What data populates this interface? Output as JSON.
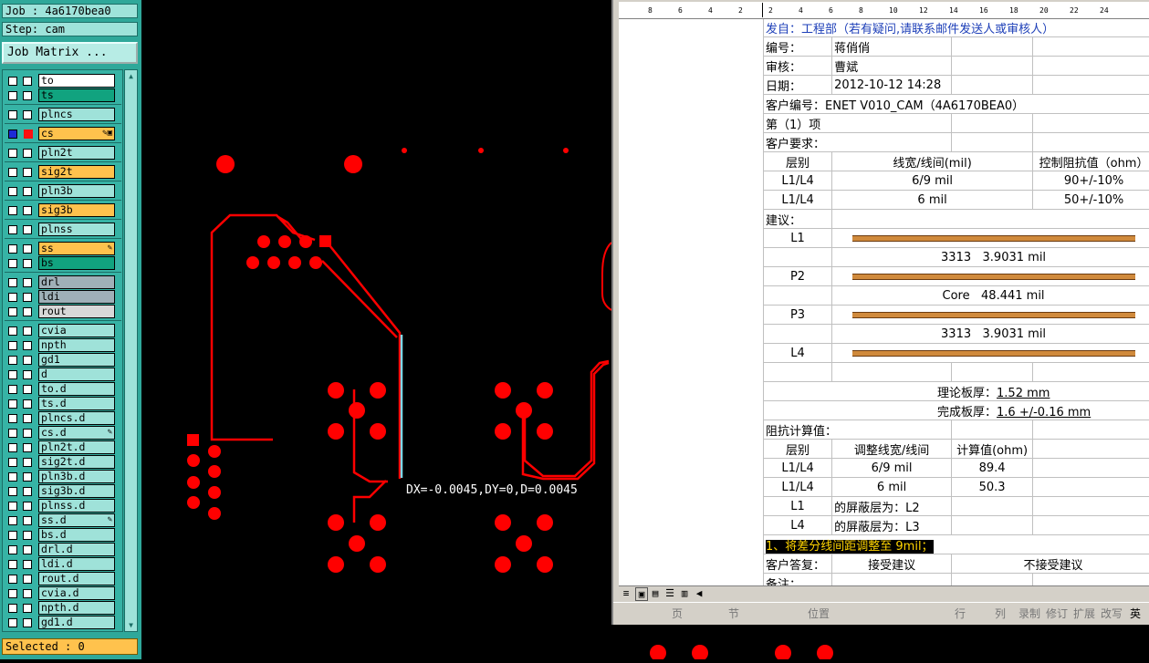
{
  "left_panel": {
    "job_label": "Job : 4a6170bea0",
    "step_label": "Step: cam",
    "matrix_button": "Job Matrix ...",
    "selected_label": "Selected : 0",
    "layers": [
      {
        "name": "to",
        "color": "#ffffff",
        "mark": ""
      },
      {
        "name": "ts",
        "color": "#11a37f",
        "mark": ""
      },
      {
        "name": "plncs",
        "color": "#9fe2d9",
        "mark": ""
      },
      {
        "name": "cs",
        "color": "#ffc24d",
        "mark": "✎▣",
        "active": true
      },
      {
        "name": "pln2t",
        "color": "#9fe2d9",
        "mark": ""
      },
      {
        "name": "sig2t",
        "color": "#ffc24d",
        "mark": ""
      },
      {
        "name": "pln3b",
        "color": "#9fe2d9",
        "mark": ""
      },
      {
        "name": "sig3b",
        "color": "#ffc24d",
        "mark": ""
      },
      {
        "name": "plnss",
        "color": "#9fe2d9",
        "mark": ""
      },
      {
        "name": "ss",
        "color": "#ffc24d",
        "mark": "✎"
      },
      {
        "name": "bs",
        "color": "#11a37f",
        "mark": ""
      },
      {
        "name": "drl",
        "color": "#9fb0b8",
        "mark": ""
      },
      {
        "name": "ldi",
        "color": "#9fb0b8",
        "mark": ""
      },
      {
        "name": "rout",
        "color": "#d8d8d8",
        "mark": ""
      },
      {
        "name": "cvia",
        "color": "#9fe2d9",
        "mark": ""
      },
      {
        "name": "npth",
        "color": "#9fe2d9",
        "mark": ""
      },
      {
        "name": "gd1",
        "color": "#9fe2d9",
        "mark": ""
      },
      {
        "name": "d",
        "color": "#9fe2d9",
        "mark": ""
      },
      {
        "name": "to.d",
        "color": "#9fe2d9",
        "mark": ""
      },
      {
        "name": "ts.d",
        "color": "#9fe2d9",
        "mark": ""
      },
      {
        "name": "plncs.d",
        "color": "#9fe2d9",
        "mark": ""
      },
      {
        "name": "cs.d",
        "color": "#9fe2d9",
        "mark": "✎"
      },
      {
        "name": "pln2t.d",
        "color": "#9fe2d9",
        "mark": ""
      },
      {
        "name": "sig2t.d",
        "color": "#9fe2d9",
        "mark": ""
      },
      {
        "name": "pln3b.d",
        "color": "#9fe2d9",
        "mark": ""
      },
      {
        "name": "sig3b.d",
        "color": "#9fe2d9",
        "mark": ""
      },
      {
        "name": "plnss.d",
        "color": "#9fe2d9",
        "mark": ""
      },
      {
        "name": "ss.d",
        "color": "#9fe2d9",
        "mark": "✎"
      },
      {
        "name": "bs.d",
        "color": "#9fe2d9",
        "mark": ""
      },
      {
        "name": "drl.d",
        "color": "#9fe2d9",
        "mark": ""
      },
      {
        "name": "ldi.d",
        "color": "#9fe2d9",
        "mark": ""
      },
      {
        "name": "rout.d",
        "color": "#9fe2d9",
        "mark": ""
      },
      {
        "name": "cvia.d",
        "color": "#9fe2d9",
        "mark": ""
      },
      {
        "name": "npth.d",
        "color": "#9fe2d9",
        "mark": ""
      },
      {
        "name": "gd1.d",
        "color": "#9fe2d9",
        "mark": ""
      }
    ]
  },
  "canvas": {
    "measure_text": "DX=-0.0045,DY=0,D=0.0045",
    "pad_color": "#ff0000",
    "highlight_color": "#7fd8e8"
  },
  "word": {
    "ruler_ticks": [
      "8",
      "6",
      "4",
      "2",
      "2",
      "4",
      "6",
      "8",
      "10",
      "12",
      "14",
      "16",
      "18",
      "20",
      "22",
      "24"
    ],
    "rows": {
      "r0": "发自：工程部（若有疑问,请联系邮件发送人或审核人）",
      "r1_label": "编号：",
      "r1_value": "蒋俏俏",
      "r2_label": "审核：",
      "r2_value": "曹斌",
      "r3_label": "日期：",
      "r3_value": "2012-10-12 14:28",
      "r4": "客户编号：ENET V010_CAM（4A6170BEA0）",
      "r5": "第（1）项",
      "r6": "客户要求：",
      "h_layer": "层别",
      "h_width": "线宽/线间(mil)",
      "h_imp": "控制阻抗值（ohm）",
      "q1_layer": "L1/L4",
      "q1_width": "6/9 mil",
      "q1_imp": "90+/-10%",
      "q2_layer": "L1/L4",
      "q2_width": "6 mil",
      "q2_imp": "50+/-10%",
      "advice": "建议：",
      "s_L1": "L1",
      "s_P2": "P2",
      "s_P3": "P3",
      "s_L4": "L4",
      "d1_a": "3313",
      "d1_b": "3.9031 mil",
      "d2_a": "Core",
      "d2_b": "48.441 mil",
      "d3_a": "3313",
      "d3_b": "3.9031 mil",
      "thk_label": "理论板厚：",
      "thk_value": "1.52 mm",
      "fin_label": "完成板厚：",
      "fin_value": "1.6 +/-0.16 mm",
      "calc": "阻抗计算值：",
      "h2_layer": "层别",
      "h2_width": "调整线宽/线间",
      "h2_calc": "计算值(ohm)",
      "c1_layer": "L1/L4",
      "c1_width": "6/9 mil",
      "c1_val": "89.4",
      "c2_layer": "L1/L4",
      "c2_width": "6 mil",
      "c2_val": "50.3",
      "sh1_a": "L1",
      "sh1_b": "的屏蔽层为：",
      "sh1_c": "L2",
      "sh2_a": "L4",
      "sh2_b": "的屏蔽层为：",
      "sh2_c": "L3",
      "note1": "1、将差分线间距调整至 9mil；",
      "reply": "客户答复：",
      "accept": "接受建议",
      "reject": "不接受建议",
      "remark": "备注："
    },
    "status": {
      "page": "页",
      "section": "节",
      "position": "位置",
      "line": "行",
      "col": "列",
      "rec": "录制",
      "rev": "修订",
      "ext": "扩展",
      "ovr": "改写",
      "lang": "英"
    }
  }
}
